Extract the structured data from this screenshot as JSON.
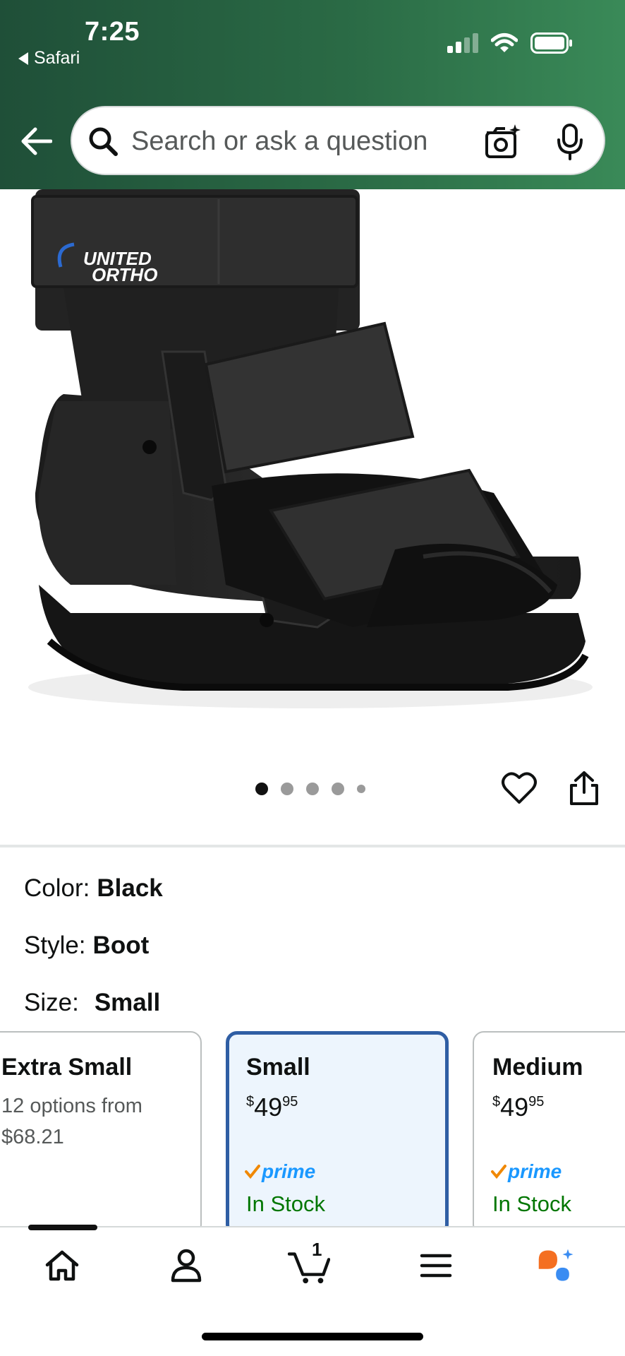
{
  "status_bar": {
    "time": "7:25",
    "back_app": "Safari"
  },
  "header": {
    "search": {
      "placeholder": "Search or ask a question",
      "value": ""
    }
  },
  "product": {
    "image_brand_text": "UNITED ORTHO",
    "image_count": 5,
    "current_image": 1
  },
  "variations": {
    "color": {
      "label": "Color:",
      "value": "Black"
    },
    "style": {
      "label": "Style:",
      "value": "Boot"
    },
    "size": {
      "label": "Size:",
      "value": "Small"
    }
  },
  "size_options": [
    {
      "name": "Extra Small",
      "line1": "12 options from",
      "line2": "$68.21",
      "selected": false
    },
    {
      "name": "Small",
      "price_symbol": "$",
      "price_whole": "49",
      "price_fraction": "95",
      "prime": "prime",
      "stock": "In Stock",
      "selected": true
    },
    {
      "name": "Medium",
      "price_symbol": "$",
      "price_whole": "49",
      "price_fraction": "95",
      "prime": "prime",
      "stock": "In Stock",
      "selected": false
    }
  ],
  "bottom_nav": {
    "cart_count": "1",
    "items": [
      "home-icon",
      "account-icon",
      "cart-icon",
      "menu-icon",
      "rufus-icon"
    ]
  },
  "colors": {
    "header_green": "#2a6a45",
    "selected_border": "#2f5ea4",
    "selected_bg": "#edf5fd",
    "prime_blue": "#1a98ff",
    "prime_check": "#f08804",
    "stock_green": "#007600",
    "rufus_orange": "#f46f21",
    "rufus_blue": "#3a8cf2"
  }
}
